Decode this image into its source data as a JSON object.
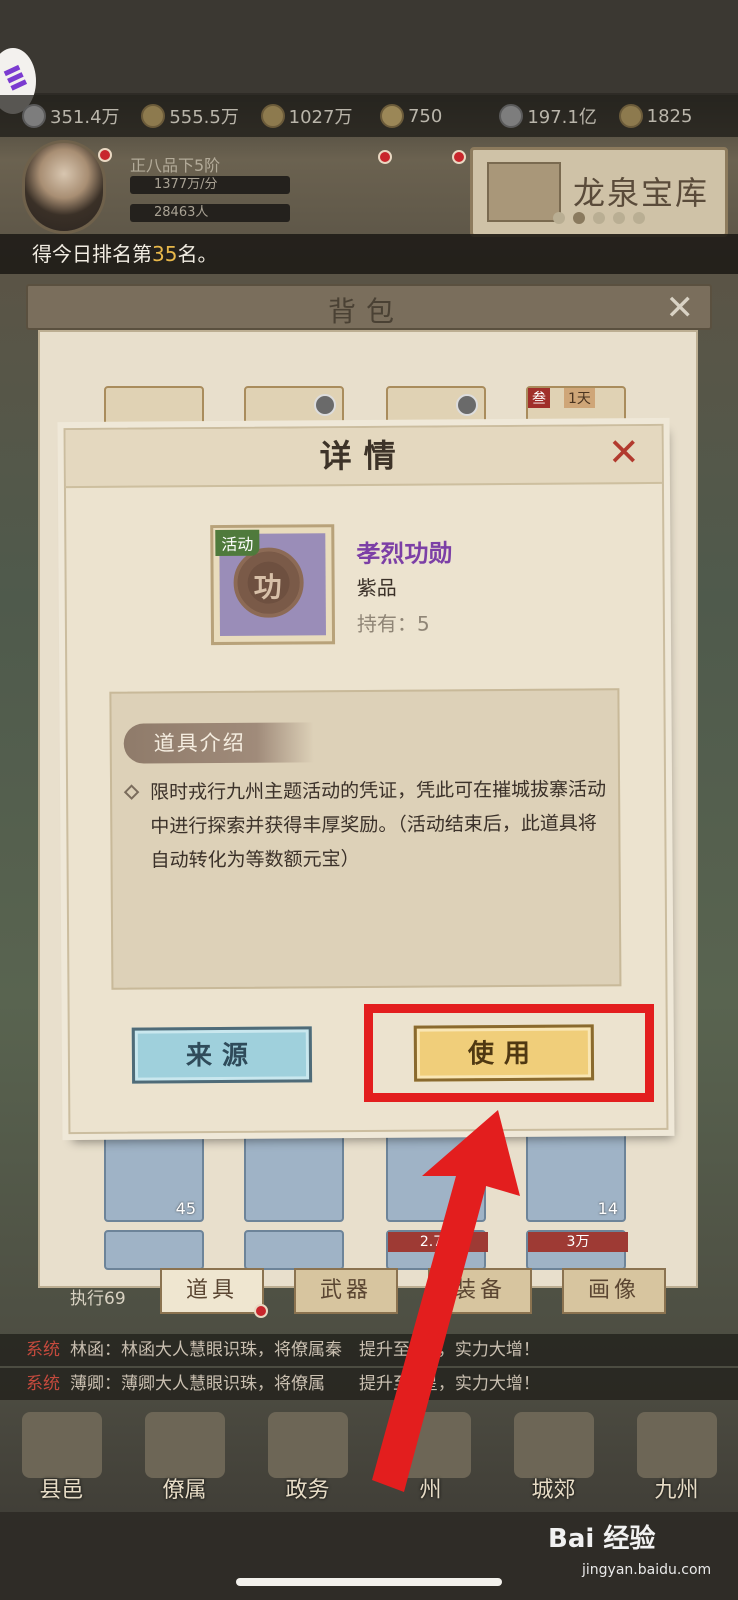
{
  "status_bar": {
    "resources": [
      {
        "icon": "reputation-icon",
        "value": "351.4万"
      },
      {
        "icon": "population-icon",
        "value": "555.5万"
      },
      {
        "icon": "grain-icon",
        "value": "1027万"
      },
      {
        "icon": "ingot-icon",
        "value": "750"
      },
      {
        "icon": "silver-icon",
        "value": "197.1亿"
      },
      {
        "icon": "lantern-icon",
        "value": "1825"
      }
    ]
  },
  "profile": {
    "rank": "正八品下5阶",
    "income": "1377万/分",
    "people": "28463人"
  },
  "treasure": {
    "title": "龙泉宝库"
  },
  "notice": {
    "prefix": "得今日排名第",
    "number": "35",
    "suffix": "名。"
  },
  "backpack": {
    "title": "背包",
    "tabs": [
      {
        "label": "道具",
        "active": true
      },
      {
        "label": "武器",
        "active": false
      },
      {
        "label": "装备",
        "active": false
      },
      {
        "label": "画像",
        "active": false
      }
    ],
    "slot_badges": {
      "top_right_tag": "叁",
      "top_right_time": "1天",
      "count_1": "45",
      "count_2": "14",
      "tag_1": "2.7万",
      "tag_2": "3万"
    }
  },
  "dialog": {
    "title": "详情",
    "item": {
      "tag": "活动",
      "glyph": "功",
      "name": "孝烈功勋",
      "grade": "紫品",
      "owned": "持有：5"
    },
    "section_label": "道具介绍",
    "description": "限时戎行九州主题活动的凭证，凭此可在摧城拔寨活动中进行探索并获得丰厚奖励。（活动结束后，此道具将自动转化为等数额元宝）",
    "buttons": {
      "source": "来源",
      "use": "使用"
    }
  },
  "status_row": "执行69",
  "chat": [
    {
      "sys": "系统",
      "text": "林函：林函大人慧眼识珠，将僚属秦　提升至4星，实力大增！"
    },
    {
      "sys": "系统",
      "text": "薄卿：薄卿大人慧眼识珠，将僚属　　提升至3星，实力大增！"
    }
  ],
  "bottom_nav": [
    {
      "label": "县邑",
      "icon": "county-icon"
    },
    {
      "label": "僚属",
      "icon": "staff-icon"
    },
    {
      "label": "政务",
      "icon": "affairs-icon"
    },
    {
      "label": "州",
      "icon": "state-icon"
    },
    {
      "label": "城郊",
      "icon": "suburb-icon"
    },
    {
      "label": "九州",
      "icon": "jiuzhou-icon"
    }
  ],
  "watermark": {
    "brand": "Bai 经验",
    "url": "jingyan.baidu.com"
  },
  "colors": {
    "highlight": "#e31e1e",
    "item_name": "#7c3fa6",
    "rank_number": "#e8b84a"
  }
}
